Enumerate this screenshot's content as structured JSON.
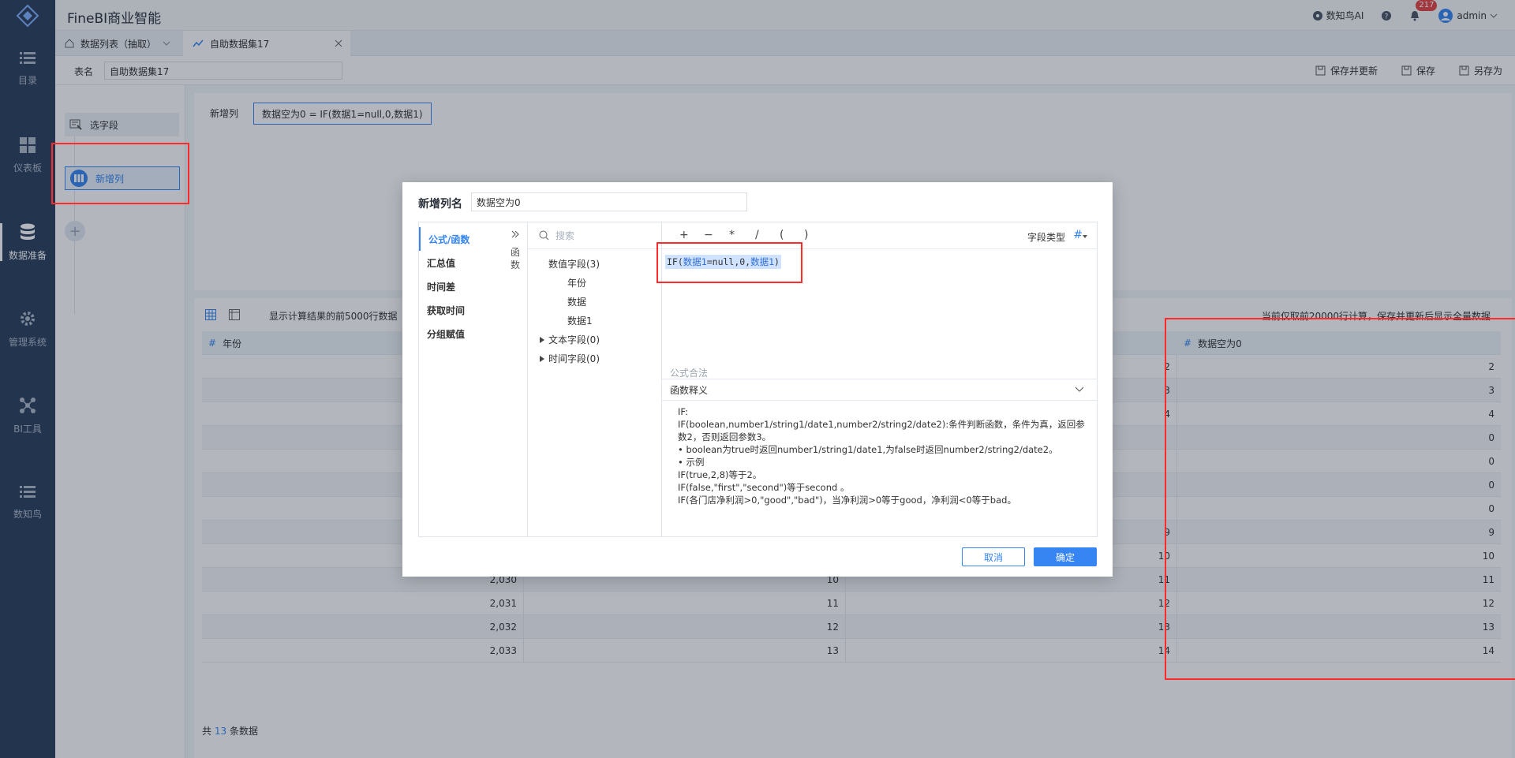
{
  "app": {
    "title": "FineBI商业智能"
  },
  "topbar": {
    "ai_label": "数知鸟AI",
    "notif_count": "217",
    "user": "admin"
  },
  "nav": {
    "items": [
      {
        "label": "目录",
        "active": false
      },
      {
        "label": "仪表板",
        "active": false
      },
      {
        "label": "数据准备",
        "active": true
      },
      {
        "label": "管理系统",
        "active": false
      },
      {
        "label": "BI工具",
        "active": false
      },
      {
        "label": "数知鸟",
        "active": false
      }
    ]
  },
  "tabs": [
    {
      "label": "数据列表（抽取）"
    },
    {
      "label": "自助数据集17"
    }
  ],
  "namebar": {
    "label": "表名",
    "value": "自助数据集17",
    "save_update": "保存并更新",
    "save": "保存",
    "save_as": "另存为"
  },
  "steps": [
    {
      "label": "选字段"
    },
    {
      "label": "新增列"
    }
  ],
  "config": {
    "label": "新增列",
    "chip": "数据空为0 = IF(数据1=null,0,数据1)"
  },
  "preview": {
    "note": "显示计算结果的前5000行数据",
    "note_right": "当前仅取前20000行计算，保存并更新后显示全量数据",
    "col_year": "年份",
    "col_new": "数据空为0",
    "rows": [
      {
        "year": "",
        "data": "",
        "data1": "2",
        "new": "2"
      },
      {
        "year": "",
        "data": "",
        "data1": "3",
        "new": "3"
      },
      {
        "year": "",
        "data": "",
        "data1": "4",
        "new": "4"
      },
      {
        "year": "",
        "data": "",
        "data1": "",
        "new": "0"
      },
      {
        "year": "",
        "data": "",
        "data1": "",
        "new": "0"
      },
      {
        "year": "",
        "data": "",
        "data1": "",
        "new": "0"
      },
      {
        "year": "",
        "data": "",
        "data1": "",
        "new": "0"
      },
      {
        "year": "",
        "data": "",
        "data1": "9",
        "new": "9"
      },
      {
        "year": "",
        "data": "",
        "data1": "10",
        "new": "10"
      },
      {
        "year": "2,030",
        "data": "10",
        "data1": "11",
        "new": "11"
      },
      {
        "year": "2,031",
        "data": "11",
        "data1": "12",
        "new": "12"
      },
      {
        "year": "2,032",
        "data": "12",
        "data1": "13",
        "new": "13"
      },
      {
        "year": "2,033",
        "data": "13",
        "data1": "14",
        "new": "14"
      }
    ],
    "footer_prefix": "共",
    "footer_count": "13",
    "footer_suffix": "条数据"
  },
  "modal": {
    "title_label": "新增列名",
    "title_value": "数据空为0",
    "categories": [
      "公式/函数",
      "汇总值",
      "时间差",
      "获取时间",
      "分组赋值"
    ],
    "side_label": "函数",
    "search_placeholder": "搜索",
    "field_groups": {
      "numeric": "数值字段(3)",
      "numeric_items": [
        "年份",
        "数据",
        "数据1"
      ],
      "text": "文本字段(0)",
      "time": "时间字段(0)"
    },
    "ops": [
      "+",
      "−",
      "*",
      "/",
      "(",
      ")"
    ],
    "field_type_label": "字段类型",
    "field_type_icon": "#",
    "formula_prefix": "IF(",
    "formula_tok1": "数据1",
    "formula_mid": "=null,0,",
    "formula_tok2": "数据1",
    "formula_suffix": ")",
    "legal": "公式合法",
    "explain_title": "函数释义",
    "explain_lines": [
      "IF:",
      "IF(boolean,number1/string1/date1,number2/string2/date2):条件判断函数，条件为真，返回参数2，否则返回参数3。",
      "• boolean为true时返回number1/string1/date1,为false时返回number2/string2/date2。",
      "• 示例",
      "IF(true,2,8)等于2。",
      "IF(false,\"first\",\"second\")等于second 。",
      "IF(各门店净利润>0,\"good\",\"bad\")，当净利润>0等于good，净利润<0等于bad。"
    ],
    "cancel": "取消",
    "ok": "确定"
  }
}
